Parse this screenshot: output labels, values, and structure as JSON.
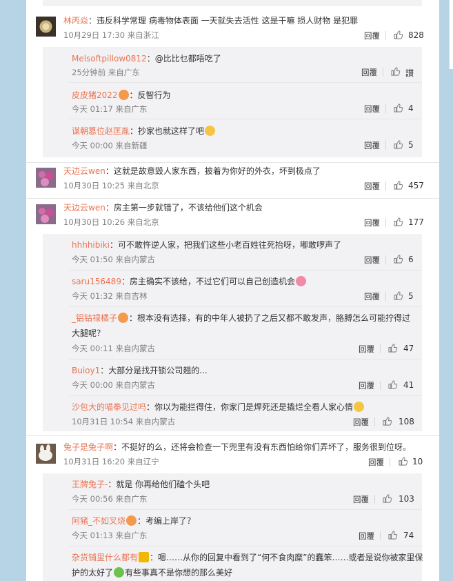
{
  "colors": {
    "page_bg": "#b7d3e6",
    "name": "#eb7350",
    "reply_bg": "#f2f2f5",
    "meta": "#808080"
  },
  "icons": {
    "like": "thumbs-up-icon"
  },
  "comments": [
    {
      "user": "林丙焱",
      "text": "：违反科学常理 病毒物体表面 一天就失去活性 这是干嘛 损人财物 是犯罪",
      "time": "10月29日 17:30 来自浙江",
      "reply": "回覆",
      "likes": "828",
      "replies": [
        {
          "user": "Melsoftpillow0812",
          "text": "：@比比乜都唔吃了",
          "time": "25分钟前 来自广东",
          "reply": "回覆",
          "likes": "讃"
        },
        {
          "user": "皮皮猪2022",
          "text": "：反智行为",
          "time": "今天 01:17 来自广东",
          "reply": "回覆",
          "likes": "4"
        },
        {
          "user": "谋朝篡位赵匡胤",
          "text": "：抄家也就这样了吧",
          "time": "今天 00:00 来自新疆",
          "reply": "回覆",
          "likes": "5"
        }
      ]
    },
    {
      "user": "天边云wen",
      "text": "：这就是故意毁人家东西，披着为你好的外衣，坏到极点了",
      "time": "10月30日 10:25 来自北京",
      "reply": "回覆",
      "likes": "457",
      "replies": []
    },
    {
      "user": "天边云wen",
      "text": "：房主第一步就错了，不该给他们这个机会",
      "time": "10月30日 10:26 来自北京",
      "reply": "回覆",
      "likes": "177",
      "replies": [
        {
          "user": "hhhhibiki",
          "text": "：可不敢忤逆人家，把我们这些小老百姓往死抬呀，嘟敢啰声了",
          "time": "今天 01:50 来自内蒙古",
          "reply": "回覆",
          "likes": "6"
        },
        {
          "user": "saru156489",
          "text": "：房主确实不该给，不过它们可以自己创造机会",
          "time": "今天 01:32 来自吉林",
          "reply": "回覆",
          "likes": "5"
        },
        {
          "user": "_铝钴禄橘子",
          "text": "：根本没有选择，有的中年人被扔了之后又都不敢发声，胳膊怎么可能拧得过",
          "text2": "大腿呢？",
          "time": "今天 00:11 来自内蒙古",
          "reply": "回覆",
          "likes": "47"
        },
        {
          "user": "Buioy1",
          "text": "：大部分是找开锁公司翘的...",
          "time": "今天 00:00 来自内蒙古",
          "reply": "回覆",
          "likes": "41"
        },
        {
          "user": "沙包大的喵拳见过吗",
          "text": "：你以为能拦得住，你家门是焊死还是撬烂全看人家心情",
          "time": "10月31日 10:54 来自内蒙古",
          "reply": "回覆",
          "likes": "108"
        }
      ]
    },
    {
      "user": "兔子是兔子啊",
      "text": "：不挺好的么，还将会检查一下兜里有没有东西怕给你们弄坏了，服务很到位呀。",
      "time": "10月31日 16:20 来自辽宁",
      "reply": "回覆",
      "likes": "10",
      "replies": [
        {
          "user": "王牌兔子-",
          "text": "：就是 你再给他们磕个头吧",
          "time": "今天 00:56 来自广东",
          "reply": "回覆",
          "likes": "103"
        },
        {
          "user": "阿猪_不如叉烧",
          "text": "：考编上岸了？",
          "time": "今天 01:13 来自广东",
          "reply": "回覆",
          "likes": "74"
        },
        {
          "user": "杂货铺里什么都有",
          "text": "：嗯……从你的回复中看到了“何不食肉糜”的蠢笨……或者是说你被家里保",
          "text2a": "护的太好了",
          "text2b": "有些事真不是你想的那么美好",
          "time": "",
          "reply": "",
          "likes": ""
        }
      ]
    }
  ]
}
